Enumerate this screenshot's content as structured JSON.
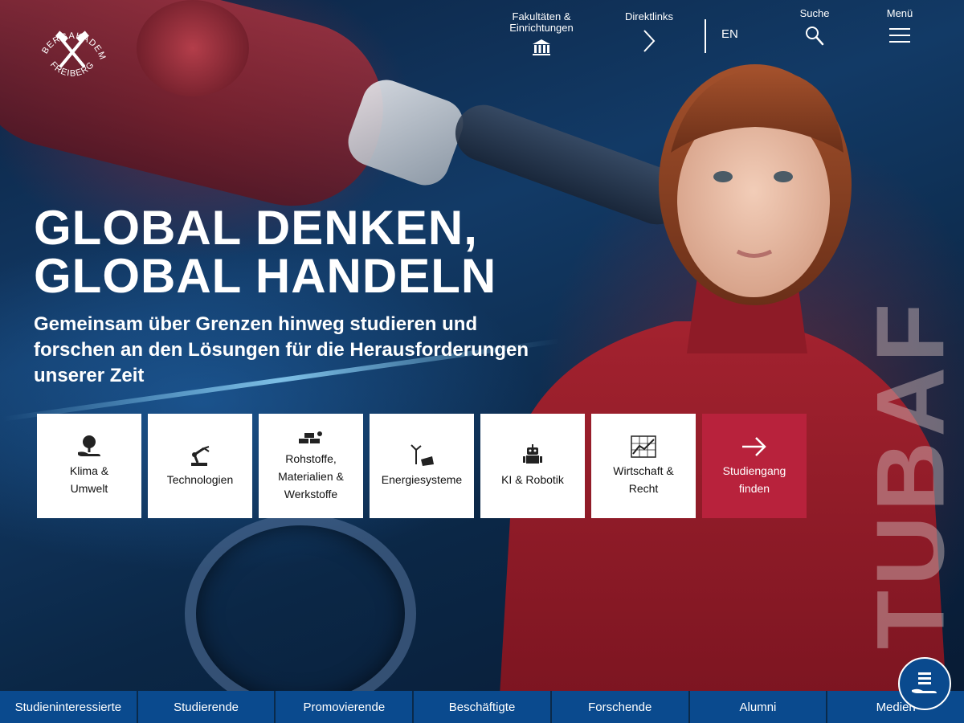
{
  "logo": {
    "top_text": "TU BERGAKADEMIE",
    "bottom_text": "FREIBERG"
  },
  "header": {
    "faculties_label_line1": "Fakultäten &",
    "faculties_label_line2": "Einrichtungen",
    "directlinks_label": "Direktlinks",
    "language_label": "EN",
    "search_label": "Suche",
    "menu_label": "Menü"
  },
  "hero": {
    "headline_line1": "GLOBAL DENKEN,",
    "headline_line2": "GLOBAL HANDELN",
    "subline": "Gemeinsam über Grenzen hinweg studieren und forschen an den Lösungen für die Herausforderungen unserer Zeit",
    "vertical_text": "TUBAF"
  },
  "tiles": [
    {
      "label_line1": "Klima &",
      "label_line2": "Umwelt",
      "icon": "tree-hand-icon"
    },
    {
      "label_line1": "Technologien",
      "label_line2": "",
      "icon": "robot-arm-icon"
    },
    {
      "label_line1": "Rohstoffe,",
      "label_line2": "Materialien &",
      "label_line3": "Werkstoffe",
      "icon": "materials-icon"
    },
    {
      "label_line1": "Energiesysteme",
      "label_line2": "",
      "icon": "wind-solar-icon"
    },
    {
      "label_line1": "KI & Robotik",
      "label_line2": "",
      "icon": "robot-icon"
    },
    {
      "label_line1": "Wirtschaft &",
      "label_line2": "Recht",
      "icon": "chart-icon"
    },
    {
      "label_line1": "Studiengang",
      "label_line2": "finden",
      "icon": "arrow-right-icon"
    }
  ],
  "bottom_nav": [
    "Studieninteressierte",
    "Studierende",
    "Promovierende",
    "Beschäftigte",
    "Forschende",
    "Alumni",
    "Medien"
  ],
  "colors": {
    "accent_red": "#b8223c",
    "nav_blue": "#0a4a8e"
  }
}
